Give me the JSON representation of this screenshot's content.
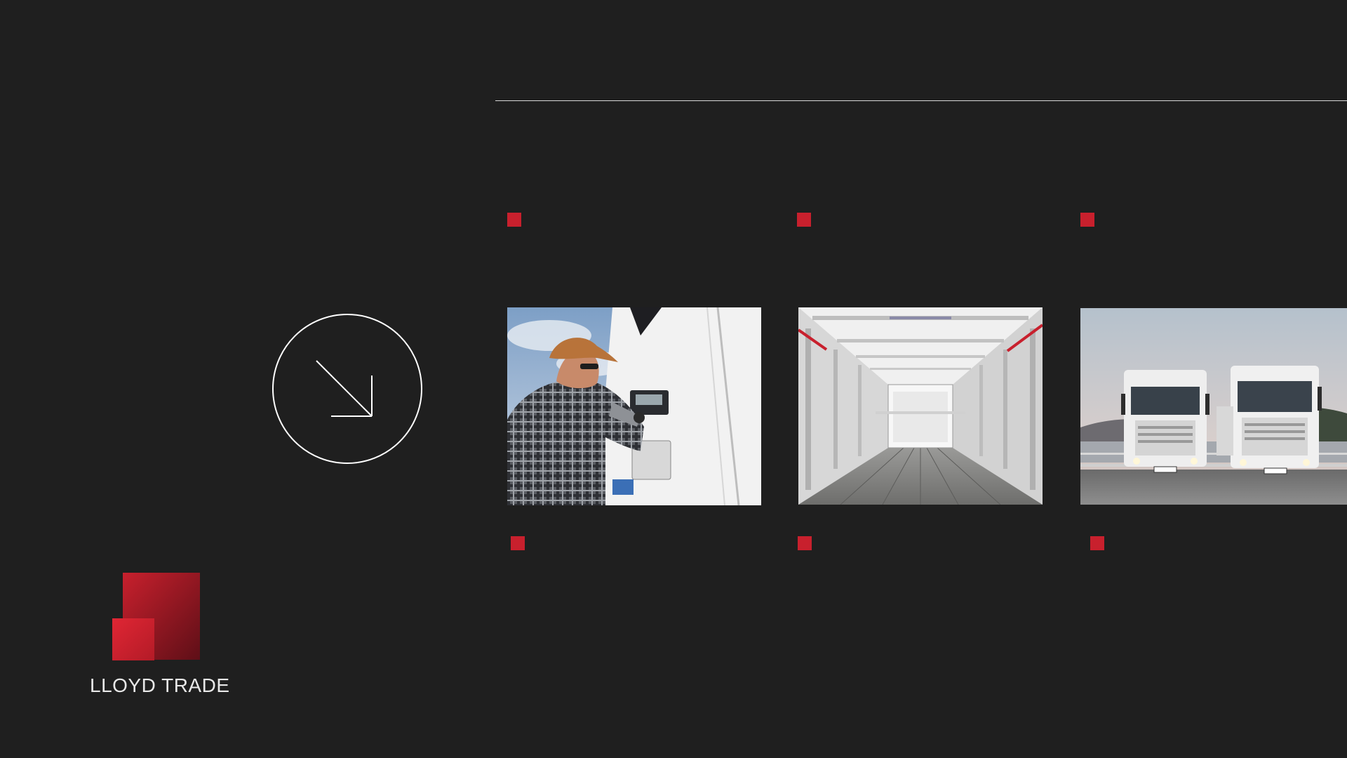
{
  "brand": {
    "name": "LLOYD TRADE",
    "accent_color": "#c8202d",
    "logo_icon": "lloyd-trade-logo-icon"
  },
  "navigation": {
    "next_icon": "arrow-down-right-icon"
  },
  "cards": [
    {
      "image": "technician-checking-reefer-panel"
    },
    {
      "image": "refrigerated-trailer-interior"
    },
    {
      "image": "scania-trucks-on-road"
    }
  ]
}
